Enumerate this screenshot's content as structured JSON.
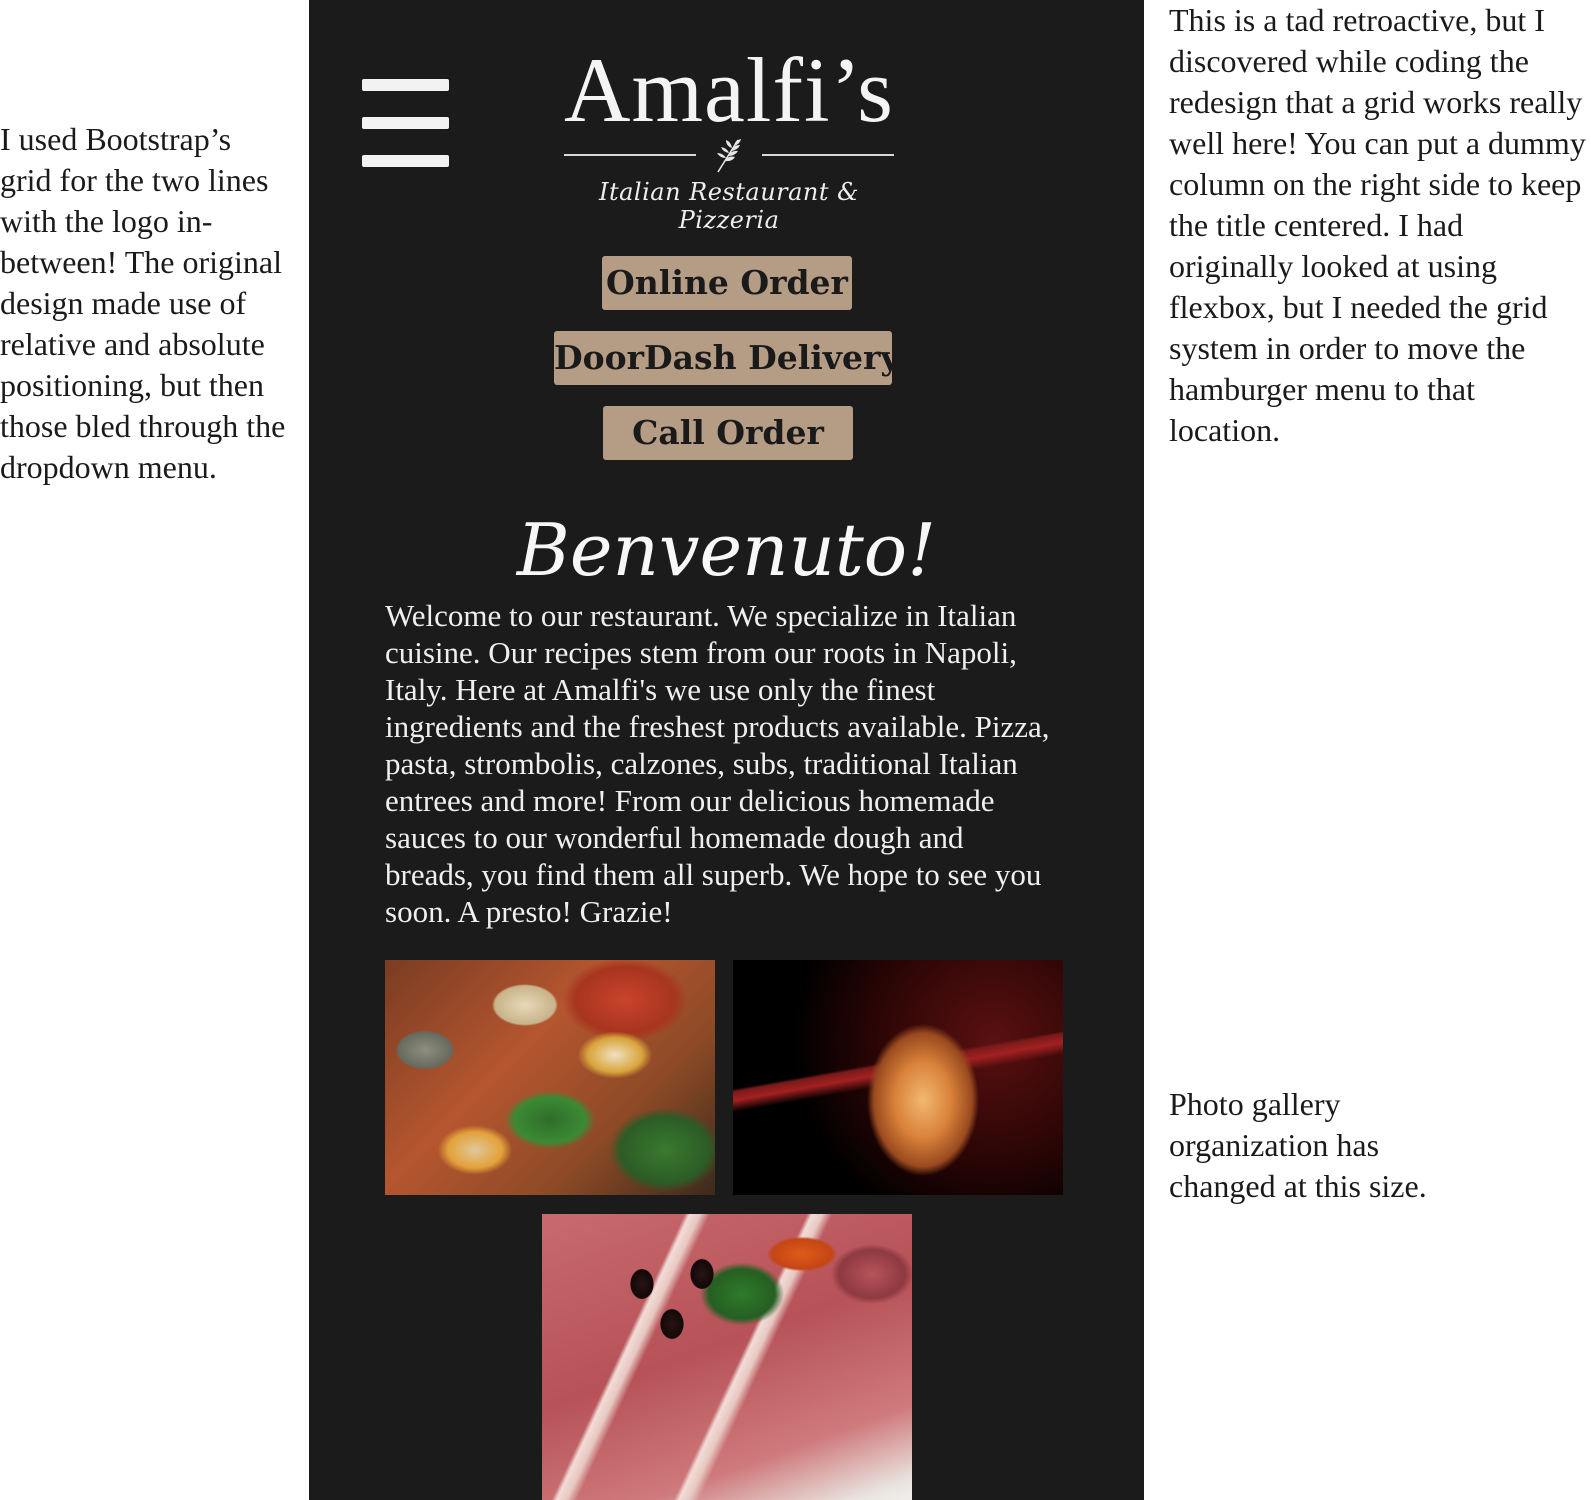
{
  "annotations": {
    "left": "I used Bootstrap’s grid for the two lines with the logo in-between! The original design made use of relative and absolute positioning, but then those bled through the dropdown menu.",
    "right_top": "This is a tad retroactive, but I discovered while coding the redesign that a grid works really well here! You can put a dummy column on the right side to keep the title centered. I had originally looked at using flexbox, but I needed the grid system in order to move the hamburger menu to that location.",
    "right_gallery": "Photo gallery organization has changed at this size."
  },
  "site": {
    "colors": {
      "background": "#1b1b1b",
      "button": "#b59c85",
      "text": "#efefef"
    },
    "header": {
      "menu_icon": "hamburger-menu-icon",
      "logo_title": "Amalfi’s",
      "logo_icon": "wheat-leaf-icon",
      "logo_subtitle": "Italian Restaurant & Pizzeria"
    },
    "actions": {
      "online_order": "Online Order",
      "doordash_delivery": "DoorDash Delivery",
      "call_order": "Call Order"
    },
    "welcome": {
      "heading": "Benvenuto!",
      "body": "Welcome to our restaurant. We specialize in Italian cuisine. Our recipes stem from our roots in Napoli, Italy.  Here at Amalfi's we use only the finest ingredients and the freshest products available. Pizza, pasta, strombolis, calzones, subs, traditional Italian entrees and more! From our delicious homemade sauces to our wonderful homemade dough and breads, you find them all superb.  We hope to see you soon.  A presto!  Grazie!"
    },
    "gallery": [
      {
        "name": "clams-seafood-photo"
      },
      {
        "name": "wine-glass-photo"
      },
      {
        "name": "charcuterie-photo"
      }
    ]
  }
}
